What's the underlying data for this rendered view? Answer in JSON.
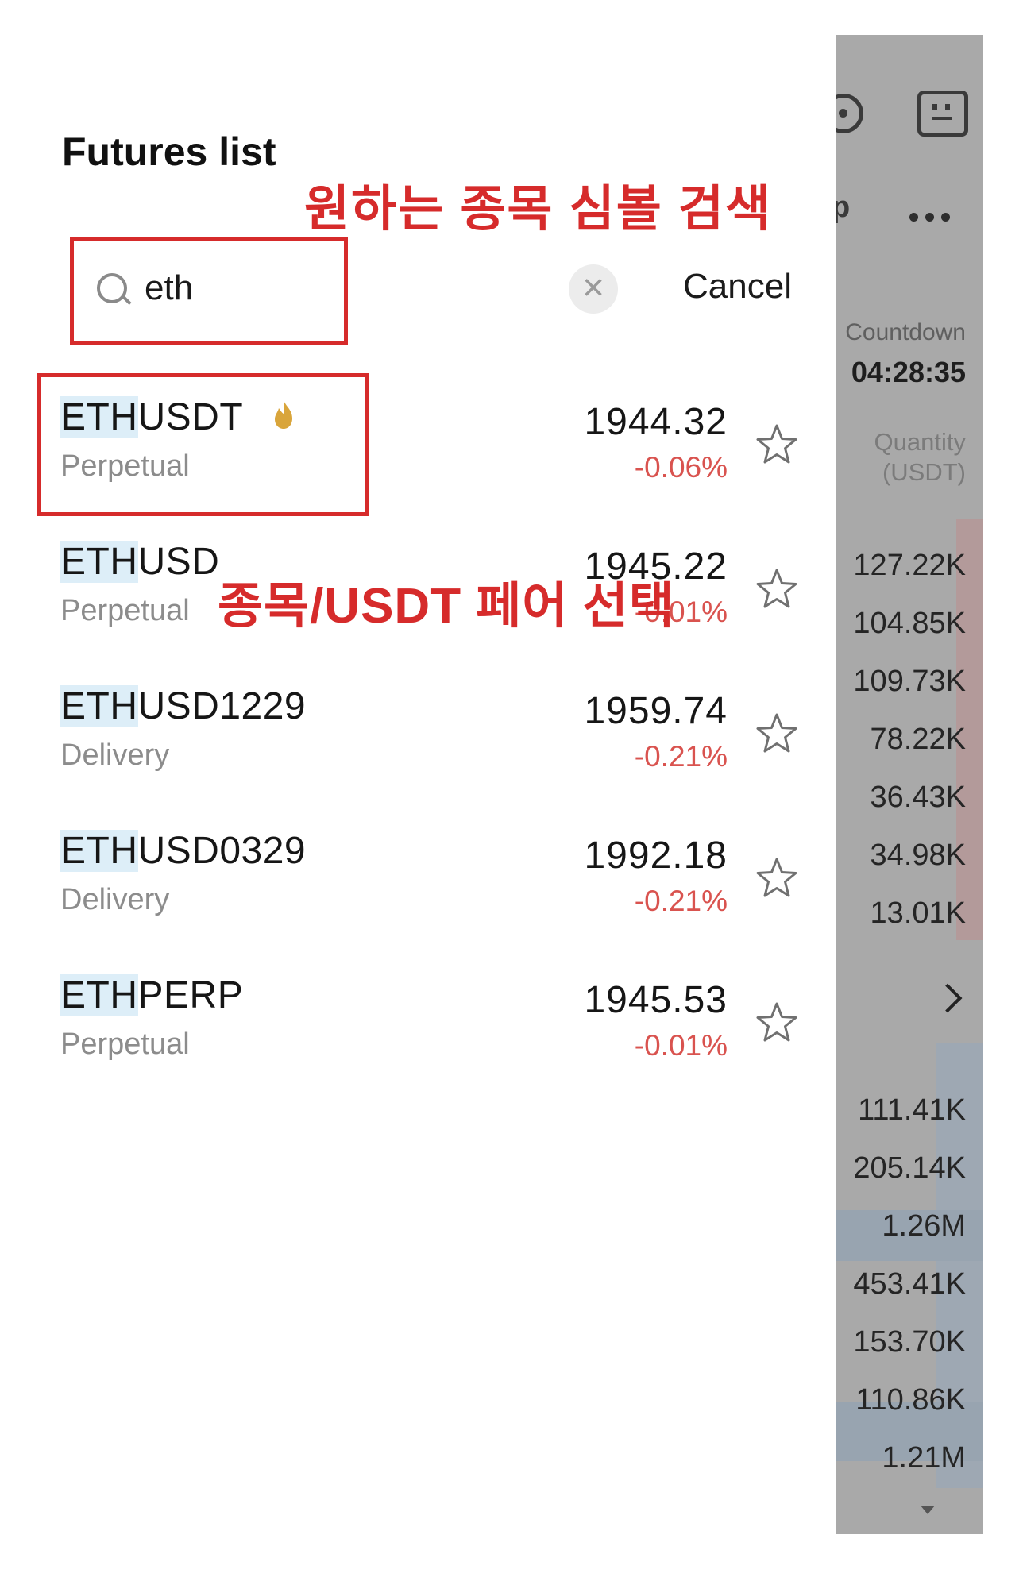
{
  "title": "Futures list",
  "annotations": {
    "search_hint": "원하는 종목 심볼 검색",
    "select_hint": "종목/USDT 페어 선택"
  },
  "search": {
    "query": "eth",
    "cancel_label": "Cancel",
    "clear_icon": "×"
  },
  "results": [
    {
      "highlight": "ETH",
      "rest": "USDT",
      "type": "Perpetual",
      "price": "1944.32",
      "change": "-0.06%",
      "hot": true
    },
    {
      "highlight": "ETH",
      "rest": "USD",
      "type": "Perpetual",
      "price": "1945.22",
      "change": "-0.01%",
      "hot": false
    },
    {
      "highlight": "ETH",
      "rest": "USD1229",
      "type": "Delivery",
      "price": "1959.74",
      "change": "-0.21%",
      "hot": false
    },
    {
      "highlight": "ETH",
      "rest": "USD0329",
      "type": "Delivery",
      "price": "1992.18",
      "change": "-0.21%",
      "hot": false
    },
    {
      "highlight": "ETH",
      "rest": "PERP",
      "type": "Perpetual",
      "price": "1945.53",
      "change": "-0.01%",
      "hot": false
    }
  ],
  "background": {
    "fragment": "p",
    "countdown_label": "Countdown",
    "countdown_value": "04:28:35",
    "quantity_label_1": "Quantity",
    "quantity_label_2": "(USDT)",
    "asks": [
      "127.22K",
      "104.85K",
      "109.73K",
      "78.22K",
      "36.43K",
      "34.98K",
      "13.01K"
    ],
    "bids": [
      "111.41K",
      "205.14K",
      "1.26M",
      "453.41K",
      "153.70K",
      "110.86K",
      "1.21M"
    ]
  },
  "colors": {
    "annotation_red": "#d62b2b",
    "negative_change": "#d9534f",
    "highlight_bg": "#ddeef8",
    "hot_icon": "#d9a53b"
  }
}
